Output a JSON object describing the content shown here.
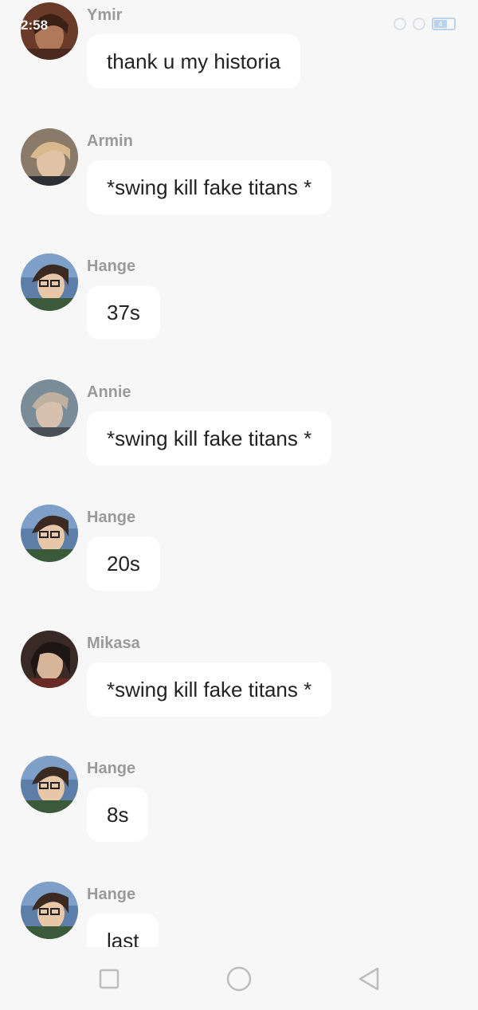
{
  "status_bar": {
    "time": "2:58",
    "battery": "4"
  },
  "messages": [
    {
      "sender": "Ymir",
      "text": "thank u my historia",
      "avatar": "ymir-avatar"
    },
    {
      "sender": "Armin",
      "text": "*swing kill fake titans *",
      "avatar": "armin-avatar"
    },
    {
      "sender": "Hange",
      "text": "37s",
      "avatar": "hange-avatar"
    },
    {
      "sender": "Annie",
      "text": "*swing kill fake titans *",
      "avatar": "annie-avatar"
    },
    {
      "sender": "Hange",
      "text": "20s",
      "avatar": "hange-avatar"
    },
    {
      "sender": "Mikasa",
      "text": "*swing kill fake titans *",
      "avatar": "mikasa-avatar"
    },
    {
      "sender": "Hange",
      "text": "8s",
      "avatar": "hange-avatar"
    },
    {
      "sender": "Hange",
      "text": "last",
      "avatar": "hange-avatar"
    }
  ],
  "nav_bar": {
    "recents_icon": "square-icon",
    "home_icon": "circle-icon",
    "back_icon": "triangle-back-icon"
  },
  "colors": {
    "background": "#f7f7f7",
    "bubble": "#ffffff",
    "sender_name": "#9a9a9a",
    "text": "#222222"
  }
}
